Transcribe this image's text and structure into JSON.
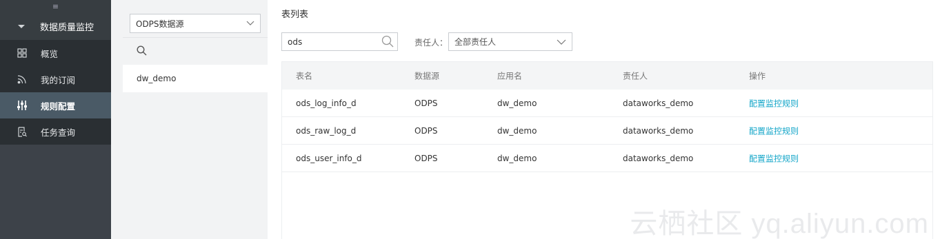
{
  "nav": {
    "toggle_glyph": "≡",
    "section_label": "数据质量监控",
    "items": [
      {
        "label": "概览",
        "icon": "grid-icon",
        "active": false
      },
      {
        "label": "我的订阅",
        "icon": "rss-icon",
        "active": false
      },
      {
        "label": "规则配置",
        "icon": "sliders-icon",
        "active": true
      },
      {
        "label": "任务查询",
        "icon": "task-search-icon",
        "active": false
      }
    ]
  },
  "datasource": {
    "selected": "ODPS数据源",
    "project": "dw_demo"
  },
  "main": {
    "title": "表列表",
    "search_value": "ods",
    "owner_label": "责任人：",
    "owner_selected": "全部责任人"
  },
  "table": {
    "headers": [
      "表名",
      "数据源",
      "应用名",
      "责任人",
      "操作"
    ],
    "rows": [
      {
        "name": "ods_log_info_d",
        "source": "ODPS",
        "app": "dw_demo",
        "owner": "dataworks_demo",
        "action": "配置监控规则"
      },
      {
        "name": "ods_raw_log_d",
        "source": "ODPS",
        "app": "dw_demo",
        "owner": "dataworks_demo",
        "action": "配置监控规则"
      },
      {
        "name": "ods_user_info_d",
        "source": "ODPS",
        "app": "dw_demo",
        "owner": "dataworks_demo",
        "action": "配置监控规则"
      }
    ]
  },
  "watermark": "云栖社区 yq.aliyun.com",
  "colors": {
    "nav_bg": "#3d4249",
    "nav_item_bg": "#2a2f33",
    "nav_active_bg": "#4a5a66",
    "link": "#12a5c8"
  }
}
